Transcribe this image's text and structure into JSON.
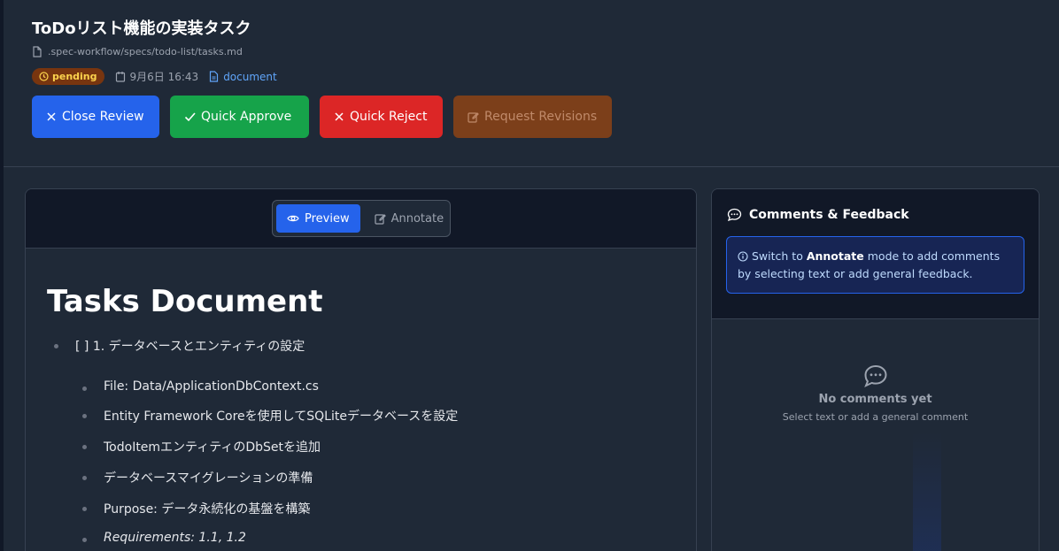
{
  "header": {
    "title": "ToDoリスト機能の実装タスク",
    "file_path": ".spec-workflow/specs/todo-list/tasks.md",
    "status_badge": "pending",
    "date": "9月6日 16:43",
    "doc_type": "document"
  },
  "actions": {
    "close_review": "Close Review",
    "quick_approve": "Quick Approve",
    "quick_reject": "Quick Reject",
    "request_revisions": "Request Revisions"
  },
  "view_toggle": {
    "preview": "Preview",
    "annotate": "Annotate",
    "active": "preview"
  },
  "document": {
    "heading": "Tasks Document",
    "items": [
      {
        "text": "[ ] 1. データベースとエンティティの設定",
        "sub": [
          "File: Data/ApplicationDbContext.cs",
          "Entity Framework Coreを使用してSQLiteデータベースを設定",
          "TodoItemエンティティのDbSetを追加",
          "データベースマイグレーションの準備",
          "Purpose: データ永続化の基盤を構築",
          "Requirements: 1.1, 1.2"
        ]
      }
    ]
  },
  "comments": {
    "title": "Comments & Feedback",
    "info_prefix": "Switch to ",
    "info_bold": "Annotate",
    "info_suffix": " mode to add comments by selecting text or add general feedback.",
    "empty_title": "No comments yet",
    "empty_sub": "Select text or add a general comment"
  },
  "colors": {
    "accent_blue": "#2563eb",
    "approve_green": "#16a34a",
    "reject_red": "#dc2626",
    "revise_orange": "#7c3f1a",
    "pending_badge": "#78350f"
  },
  "icons": {
    "file": "file-icon",
    "clock": "clock-icon",
    "calendar": "calendar-icon",
    "doc": "document-icon",
    "close": "x-icon",
    "check": "check-icon",
    "edit": "edit-icon",
    "eye": "eye-icon",
    "chat": "chat-bubble-icon",
    "info": "info-icon"
  }
}
